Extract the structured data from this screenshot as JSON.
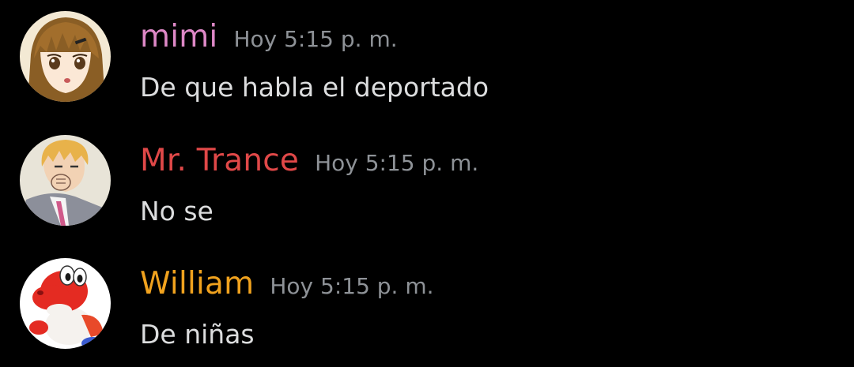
{
  "colors": {
    "background": "#000000",
    "timestamp": "#8e9297",
    "message_text": "#dcddde"
  },
  "messages": [
    {
      "author": "mimi",
      "author_color": "#dd88c6",
      "timestamp": "Hoy 5:15 p. m.",
      "text": "De que habla el deportado",
      "avatar_icon": "anime-girl-avatar-icon"
    },
    {
      "author": "Mr. Trance",
      "author_color": "#e04848",
      "timestamp": "Hoy 5:15 p. m.",
      "text": "No se",
      "avatar_icon": "anime-man-avatar-icon"
    },
    {
      "author": "William",
      "author_color": "#f0a21e",
      "timestamp": "Hoy 5:15 p. m.",
      "text": "De niñas",
      "avatar_icon": "red-yoshi-avatar-icon"
    }
  ]
}
